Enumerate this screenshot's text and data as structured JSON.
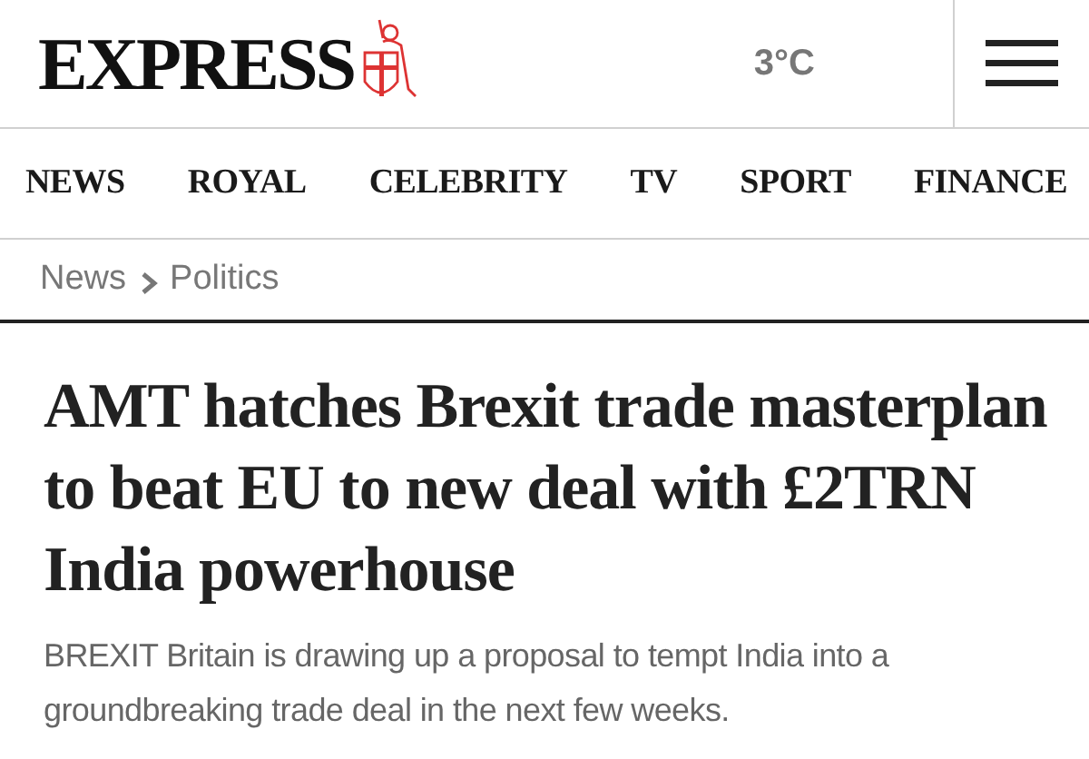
{
  "header": {
    "logo": "EXPRESS",
    "temperature": "3°C"
  },
  "nav": [
    {
      "label": "NEWS"
    },
    {
      "label": "ROYAL"
    },
    {
      "label": "CELEBRITY"
    },
    {
      "label": "TV"
    },
    {
      "label": "SPORT"
    },
    {
      "label": "FINANCE"
    }
  ],
  "breadcrumb": [
    "News",
    "Politics"
  ],
  "article": {
    "headline": "AMT hatches Brexit trade masterplan to beat EU to new deal with £2TRN India powerhouse",
    "standfirst": "BREXIT Britain is drawing up a proposal to tempt India into a groundbreaking trade deal in the next few weeks."
  }
}
